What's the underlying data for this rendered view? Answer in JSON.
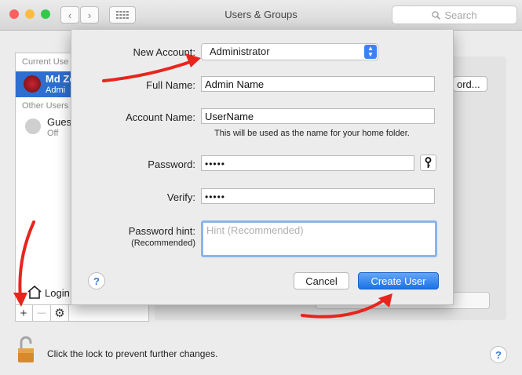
{
  "window": {
    "title": "Users & Groups",
    "search_placeholder": "Search",
    "traffic_lights": {
      "close": "#fc605c",
      "minimize": "#fdbc40",
      "zoom": "#34c84a"
    }
  },
  "toolbar": {
    "back_icon": "chevron-left-icon",
    "forward_icon": "chevron-right-icon",
    "grid_icon": "grid-icon"
  },
  "users_list": {
    "current_header": "Current Use",
    "current_user": {
      "name": "Md Ze",
      "role": "Admi"
    },
    "other_header": "Other Users",
    "guest": {
      "name": "Gues",
      "status": "Off"
    },
    "login_options": "Login",
    "add_label": "+",
    "remove_label": "—"
  },
  "background": {
    "password_button_fragment": "ord..."
  },
  "dialog": {
    "new_account_label": "New Account:",
    "account_type": "Administrator",
    "full_name_label": "Full Name:",
    "full_name_value": "Admin Name",
    "account_name_label": "Account Name:",
    "account_name_value": "UserName",
    "account_name_note": "This will be used as the name for your home folder.",
    "password_label": "Password:",
    "password_value": "•••••",
    "verify_label": "Verify:",
    "verify_value": "•••••",
    "hint_label": "Password hint:",
    "hint_sublabel": "(Recommended)",
    "hint_placeholder": "Hint (Recommended)",
    "cancel_label": "Cancel",
    "create_label": "Create User",
    "help_label": "?"
  },
  "footer": {
    "lock_text": "Click the lock to prevent further changes.",
    "help_label": "?"
  },
  "colors": {
    "accent": "#1c72e8",
    "annotation_arrow": "#e8251d"
  }
}
